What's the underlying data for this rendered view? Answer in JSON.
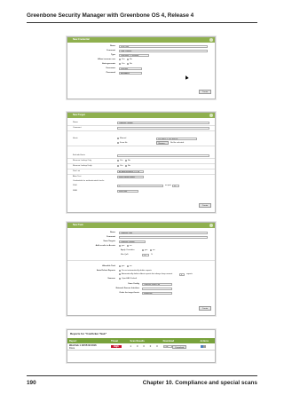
{
  "page": {
    "header": "Greenbone Security Manager with Greenbone OS 4, Release 4",
    "page_number": "190",
    "chapter": "Chapter 10.  Compliance and special scans"
  },
  "credential_dialog": {
    "title": "New Credential",
    "fields": [
      {
        "label": "Name",
        "value": "Scan User"
      },
      {
        "label": "Comment",
        "value": "Conf. Policies"
      },
      {
        "label": "Type",
        "value": "Username + Password"
      },
      {
        "label": "Allow insecure use",
        "value": ""
      },
      {
        "label": "Auto-generate",
        "value": ""
      },
      {
        "label": "Username",
        "value": "scanuser"
      },
      {
        "label": "Password",
        "value": "●●●●●●●●"
      }
    ],
    "yes": "Yes",
    "no": "No",
    "create": "Create"
  },
  "target_dialog": {
    "title": "New Target",
    "fields": [
      {
        "label": "Name",
        "value": "Conficker Targets"
      },
      {
        "label": "Comment",
        "value": ""
      },
      {
        "label": "Hosts",
        "value": ""
      },
      {
        "label": "Exclude Hosts",
        "value": ""
      },
      {
        "label": "Reverse Lookup Only",
        "value": ""
      },
      {
        "label": "Reverse Lookup Unify",
        "value": ""
      },
      {
        "label": "Port List",
        "value": "All IANA assigned TCP an"
      },
      {
        "label": "Alive Test",
        "value": "Scan Config Default"
      },
      {
        "label": "Credentials for authenticated checks",
        "value": ""
      },
      {
        "label": "SSH",
        "value": "--"
      },
      {
        "label": "SMB",
        "value": "Scan User"
      }
    ],
    "manual": "Manual",
    "manual_value": "192.168.0.1, 192.168.0.8",
    "from_file": "From file",
    "browse": "Browse...",
    "no_file": "No file selected.",
    "on_port": "on port",
    "port_value": "22",
    "yes": "Yes",
    "no": "No",
    "create": "Create"
  },
  "task_dialog": {
    "title": "New Task",
    "fields": [
      {
        "label": "Name",
        "value": "Conficker Task"
      },
      {
        "label": "Comment",
        "value": ""
      },
      {
        "label": "Scan Targets",
        "value": "Conficker Targets"
      },
      {
        "label": "Add results to Assets",
        "value": ""
      },
      {
        "label": "Alterable Task",
        "value": ""
      },
      {
        "label": "Auto Delete Reports",
        "value": ""
      },
      {
        "label": "Scanner",
        "value": "OpenVAS Default"
      },
      {
        "label": "Scan Config",
        "value": "Conficker Search on"
      },
      {
        "label": "Network Source Interface",
        "value": ""
      },
      {
        "label": "Order for target hosts",
        "value": "Sequential"
      }
    ],
    "yes": "yes",
    "no": "no",
    "apply_overrides": "Apply Overrides",
    "min_qod": "Min QoD",
    "min_qod_value": "70",
    "percent": "%",
    "auto_delete_opt1": "Do not automatically delete reports",
    "auto_delete_opt2": "Automatically delete oldest reports but always keep newest",
    "keep_value": "5",
    "reports_word": "reports",
    "create": "Create"
  },
  "reports_table": {
    "title": "Reports for \"Conficker Task\"",
    "columns": [
      "Report",
      "Threat",
      "Scan Results",
      "Download",
      "Actions"
    ],
    "subcolumns": [
      "High",
      "Medium",
      "Low",
      "Log",
      "False Pos."
    ],
    "rows": [
      {
        "date": "Wed Feb 1 18:55:02 2016",
        "status": "Done",
        "threat": "High",
        "high": "1",
        "medium": "0",
        "low": "0",
        "log": "0",
        "fp": "0",
        "format": "PDF",
        "download": "Download"
      }
    ]
  },
  "colors": {
    "dialog_header": "#8fb04f",
    "table_header": "#78a23c",
    "severity_high": "#c8102e"
  }
}
